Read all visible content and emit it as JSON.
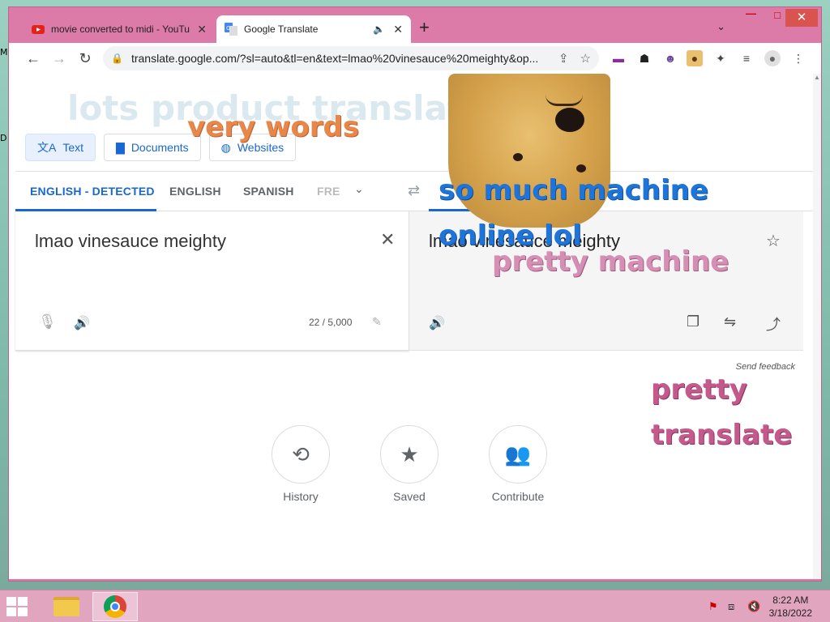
{
  "desktop": {
    "glyph_top": "M",
    "glyph_mid": "D"
  },
  "tabs": [
    {
      "title": "movie converted to midi - YouTu",
      "favicon": "youtube-icon"
    },
    {
      "title": "Google Translate",
      "favicon": "google-translate-icon"
    }
  ],
  "window_controls": {
    "minimize": "—",
    "maximize": "□",
    "close": "✕"
  },
  "address_bar": {
    "url": "translate.google.com/?sl=auto&tl=en&text=lmao%20vinesauce%20meighty&op..."
  },
  "modes": [
    {
      "label": "Text",
      "icon": "translate-icon"
    },
    {
      "label": "Documents",
      "icon": "document-icon"
    },
    {
      "label": "Websites",
      "icon": "globe-icon"
    }
  ],
  "languages": {
    "src1": "ENGLISH - DETECTED",
    "src2": "ENGLISH",
    "src3": "SPANISH",
    "src4": "FRE"
  },
  "source": {
    "text": "lmao vinesauce meighty",
    "char_count": "22 / 5,000"
  },
  "target": {
    "text": "lmao vinesauce meighty"
  },
  "feedback": "Send feedback",
  "quick_links": [
    {
      "label": "History",
      "icon": "history-icon"
    },
    {
      "label": "Saved",
      "icon": "star-icon"
    },
    {
      "label": "Contribute",
      "icon": "people-icon"
    }
  ],
  "meme_text": {
    "faint": "lots product translation plz",
    "very": "very words",
    "so_much": "so much machine",
    "online": "online lol",
    "pretty_machine": "pretty machine",
    "pretty": "pretty",
    "translate": "translate"
  },
  "taskbar": {
    "time": "8:22 AM",
    "date": "3/18/2022"
  },
  "colors": {
    "accent": "#1967d2",
    "window_frame": "#dc7aa8",
    "taskbar": "#e2a5bf"
  }
}
